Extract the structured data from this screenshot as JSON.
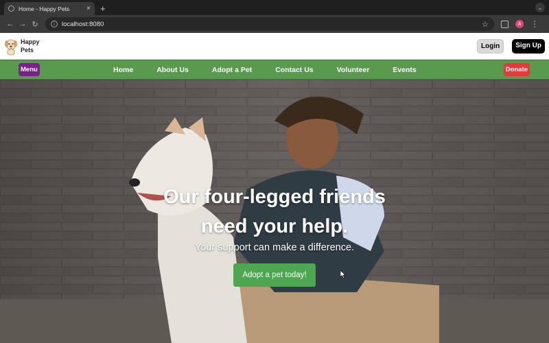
{
  "browser": {
    "tab_title": "Home - Happy Pets",
    "tab_close": "×",
    "new_tab": "+",
    "url": "localhost:8080",
    "profile_initial": "A",
    "icons": [
      "back-icon",
      "forward-icon",
      "reload-icon",
      "info-icon",
      "star-icon",
      "extensions-icon",
      "profile-icon",
      "kebab-menu-icon",
      "tab-favicon",
      "chevron-down-icon"
    ]
  },
  "header": {
    "brand_line1": "Happy",
    "brand_line2": "Pets",
    "login_label": "Login",
    "signup_label": "Sign Up"
  },
  "nav": {
    "menu_label": "Menu",
    "donate_label": "Donate",
    "links": [
      "Home",
      "About Us",
      "Adopt a Pet",
      "Contact Us",
      "Volunteer",
      "Events"
    ]
  },
  "hero": {
    "title_line1": "Our four-legged friends",
    "title_line2": "need your help.",
    "subtitle": "Your support can make a difference.",
    "cta_label": "Adopt a pet today!"
  },
  "colors": {
    "nav_green": "#5a9a4f",
    "menu_purple": "#7a1f8c",
    "donate_red": "#e23b3b",
    "cta_green": "#4da650"
  }
}
